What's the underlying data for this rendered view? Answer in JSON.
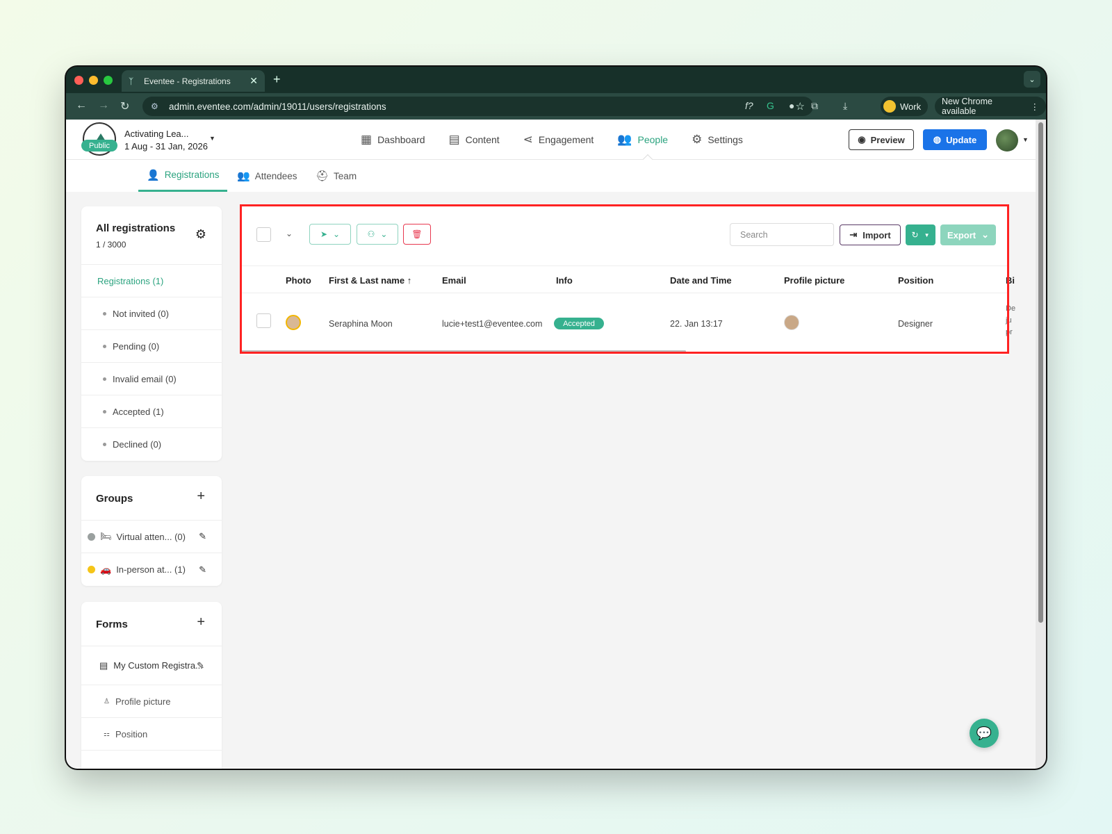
{
  "browser": {
    "tab_title": "Eventee - Registrations",
    "tab_close": "✕",
    "new_tab": "+",
    "url": "admin.eventee.com/admin/19011/users/registrations",
    "profile_label": "Work",
    "update_label": "New Chrome available"
  },
  "header": {
    "event_name": "Activating Lea...",
    "event_dates": "1 Aug - 31 Jan, 2026",
    "status_badge": "Public",
    "nav": [
      {
        "label": "Dashboard",
        "icon": "dashboard-icon"
      },
      {
        "label": "Content",
        "icon": "calendar-icon"
      },
      {
        "label": "Engagement",
        "icon": "share-icon"
      },
      {
        "label": "People",
        "icon": "people-icon",
        "active": true
      },
      {
        "label": "Settings",
        "icon": "gear-icon"
      }
    ],
    "preview_label": "Preview",
    "update_label": "Update"
  },
  "subnav": {
    "tabs": [
      {
        "label": "Registrations",
        "active": true
      },
      {
        "label": "Attendees"
      },
      {
        "label": "Team"
      }
    ]
  },
  "sidebar": {
    "registrations": {
      "title": "All registrations",
      "count": "1 / 3000",
      "items": [
        {
          "label": "Registrations (1)"
        },
        {
          "label": "Not invited (0)"
        },
        {
          "label": "Pending (0)"
        },
        {
          "label": "Invalid email (0)"
        },
        {
          "label": "Accepted (1)"
        },
        {
          "label": "Declined (0)"
        }
      ]
    },
    "groups": {
      "title": "Groups",
      "items": [
        {
          "emoji": "🛏",
          "label": "Virtual atten... (0)",
          "color": "#9aa09f"
        },
        {
          "emoji": "🚗",
          "label": "In-person at... (1)",
          "color": "#f5c518"
        }
      ]
    },
    "forms": {
      "title": "Forms",
      "items": [
        {
          "label": "My Custom Registra..."
        },
        {
          "label": "Profile picture"
        },
        {
          "label": "Position"
        }
      ]
    }
  },
  "toolbar": {
    "search_placeholder": "Search",
    "import_label": "Import",
    "export_label": "Export"
  },
  "table": {
    "columns": [
      "Photo",
      "First & Last name ↑",
      "Email",
      "Info",
      "Date and Time",
      "Profile picture",
      "Position",
      "Bi"
    ],
    "rows": [
      {
        "name": "Seraphina Moon",
        "email": "lucie+test1@eventee.com",
        "info": "Accepted",
        "datetime": "22. Jan 13:17",
        "position": "Designer",
        "bio_fragment": [
          "De",
          "ju",
          "pr"
        ]
      }
    ]
  },
  "colors": {
    "accent": "#36b18f",
    "primary_button": "#1a73e8",
    "delete": "#e8384f",
    "highlight_box": "#ff2222"
  }
}
